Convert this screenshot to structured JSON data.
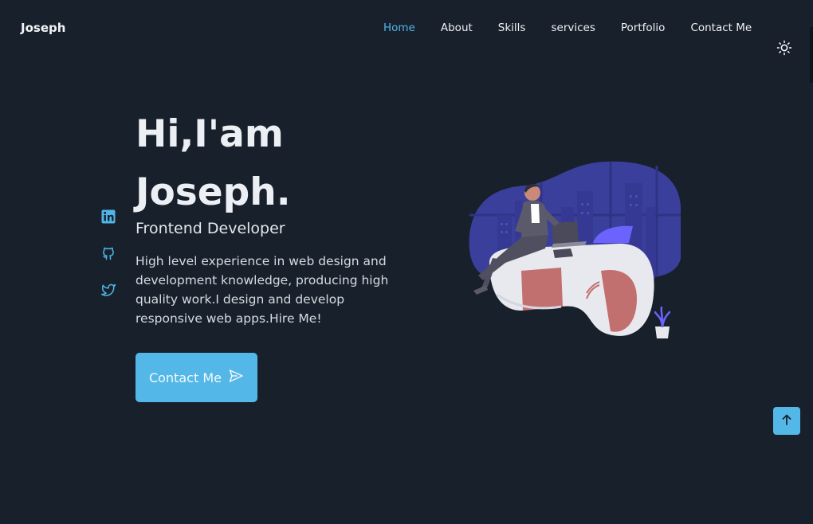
{
  "header": {
    "brand": "Joseph",
    "nav": [
      "Home",
      "About",
      "Skills",
      "services",
      "Portfolio",
      "Contact Me"
    ],
    "active_nav": "Home",
    "theme_icon": "sun-icon"
  },
  "social": {
    "icons": [
      "linkedin-icon",
      "github-icon",
      "twitter-icon"
    ]
  },
  "hero": {
    "title_line1": "Hi,I'am",
    "title_line2": "Joseph.",
    "subtitle": "Frontend Developer",
    "description": "High level experience in web design and development knowledge, producing high quality work.I design and develop responsive web apps.Hire Me!",
    "cta_label": "Contact Me",
    "cta_icon": "send-icon"
  },
  "scroll_up_icon": "arrow-up-icon",
  "colors": {
    "background": "#18202b",
    "accent": "#53b8e8",
    "nav_active": "#4fb6e8",
    "text": "#eceff3"
  }
}
